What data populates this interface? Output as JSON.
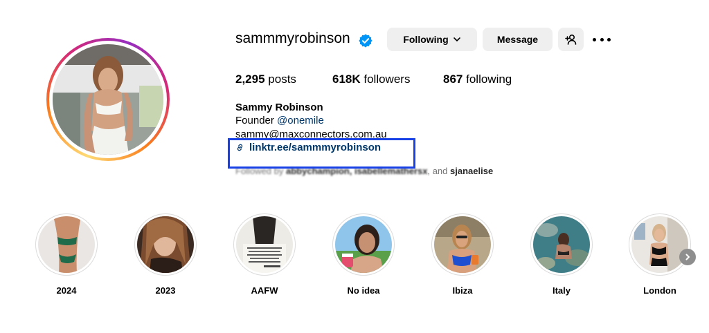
{
  "profile": {
    "username": "sammmyrobinson",
    "verified_icon": "verified-badge-icon",
    "following_label": "Following",
    "message_label": "Message",
    "add_user_icon": "add-person-icon",
    "more_icon": "more-options-icon"
  },
  "stats": {
    "posts_count": "2,295",
    "posts_label": "posts",
    "followers_count": "618K",
    "followers_label": "followers",
    "following_count": "867",
    "following_label": "following"
  },
  "bio": {
    "name": "Sammy Robinson",
    "founder_prefix": "Founder",
    "mention": "@onemile",
    "email": "sammy@maxconnectors.com.au",
    "link": "linktr.ee/sammmyrobinson",
    "followed_by_prefix": "Followed by",
    "followed_by_names": "abbychampion, isabellemathersx",
    "followed_by_sep": ", and",
    "followed_by_last": "sjanaelise"
  },
  "highlights": [
    {
      "label": "2024"
    },
    {
      "label": "2023"
    },
    {
      "label": "AAFW"
    },
    {
      "label": "No idea"
    },
    {
      "label": "Ibiza"
    },
    {
      "label": "Italy"
    },
    {
      "label": "London"
    }
  ],
  "colors": {
    "link": "#00376b",
    "button_bg": "#efefef",
    "annotation_box": "#1740e6",
    "verified": "#0095f6"
  }
}
